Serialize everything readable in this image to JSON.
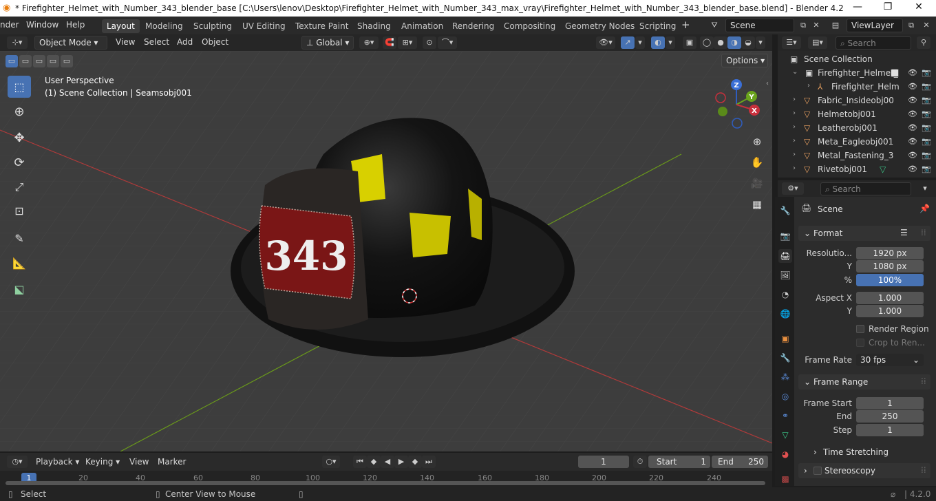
{
  "window": {
    "title": "* Firefighter_Helmet_with_Number_343_blender_base [C:\\Users\\lenov\\Desktop\\Firefighter_Helmet_with_Number_343_max_vray\\Firefighter_Helmet_with_Number_343_blender_base.blend] - Blender 4.2",
    "minimize_glyph": "—",
    "maximize_glyph": "❐",
    "close_glyph": "✕"
  },
  "menu": {
    "items": [
      "nder",
      "Window",
      "Help"
    ]
  },
  "workspaces": [
    "Layout",
    "Modeling",
    "Sculpting",
    "UV Editing",
    "Texture Paint",
    "Shading",
    "Animation",
    "Rendering",
    "Compositing",
    "Geometry Nodes",
    "Scripting"
  ],
  "add_workspace_glyph": "+",
  "scene_selector": {
    "value": "Scene"
  },
  "viewlayer_selector": {
    "value": "ViewLayer"
  },
  "viewport_header": {
    "mode": "Object Mode",
    "menus": [
      "View",
      "Select",
      "Add",
      "Object"
    ],
    "orientation": "Global",
    "options_label": "Options"
  },
  "viewport": {
    "perspective": "User Perspective",
    "collection_info": "(1) Scene Collection | Seamsobj001",
    "helmet_number": "343",
    "gizmo_axes": {
      "z": "Z",
      "y": "Y",
      "x": "X"
    },
    "accent_color": "#4772b3"
  },
  "outliner": {
    "search_placeholder": "Search",
    "root": "Scene Collection",
    "rows": [
      {
        "label": "Firefighter_Helmet_",
        "kind": "collection"
      },
      {
        "label": "Firefighter_Helm",
        "kind": "empty"
      },
      {
        "label": "Fabric_Insideobj00",
        "kind": "mesh"
      },
      {
        "label": "Helmetobj001",
        "kind": "mesh"
      },
      {
        "label": "Leatherobj001",
        "kind": "mesh"
      },
      {
        "label": "Meta_Eagleobj001",
        "kind": "mesh"
      },
      {
        "label": "Metal_Fastening_3",
        "kind": "mesh"
      },
      {
        "label": "Rivetobj001",
        "kind": "mesh"
      }
    ]
  },
  "properties": {
    "search_placeholder": "Search",
    "context": "Scene",
    "format": {
      "header": "Format",
      "resolution_x_label": "Resolutio...",
      "resolution_x": "1920 px",
      "resolution_y_label": "Y",
      "resolution_y": "1080 px",
      "percent_label": "%",
      "percent": "100%",
      "aspect_x_label": "Aspect X",
      "aspect_x": "1.000",
      "aspect_y_label": "Y",
      "aspect_y": "1.000",
      "render_region": "Render Region",
      "crop_to_render": "Crop to Ren...",
      "frame_rate_label": "Frame Rate",
      "frame_rate": "30 fps"
    },
    "frame_range": {
      "header": "Frame Range",
      "start_label": "Frame Start",
      "start": "1",
      "end_label": "End",
      "end": "250",
      "step_label": "Step",
      "step": "1",
      "time_stretching": "Time Stretching"
    },
    "stereoscopy": "Stereoscopy"
  },
  "timeline": {
    "menus": [
      "Playback",
      "Keying",
      "View",
      "Marker"
    ],
    "current_frame": "1",
    "start_label": "Start",
    "start": "1",
    "end_label": "End",
    "end": "250",
    "ticks": [
      "1",
      "20",
      "40",
      "60",
      "80",
      "100",
      "120",
      "140",
      "160",
      "180",
      "200",
      "220",
      "240"
    ]
  },
  "statusbar": {
    "select": "Select",
    "center_view": "Center View to Mouse",
    "version": "4.2.0"
  }
}
